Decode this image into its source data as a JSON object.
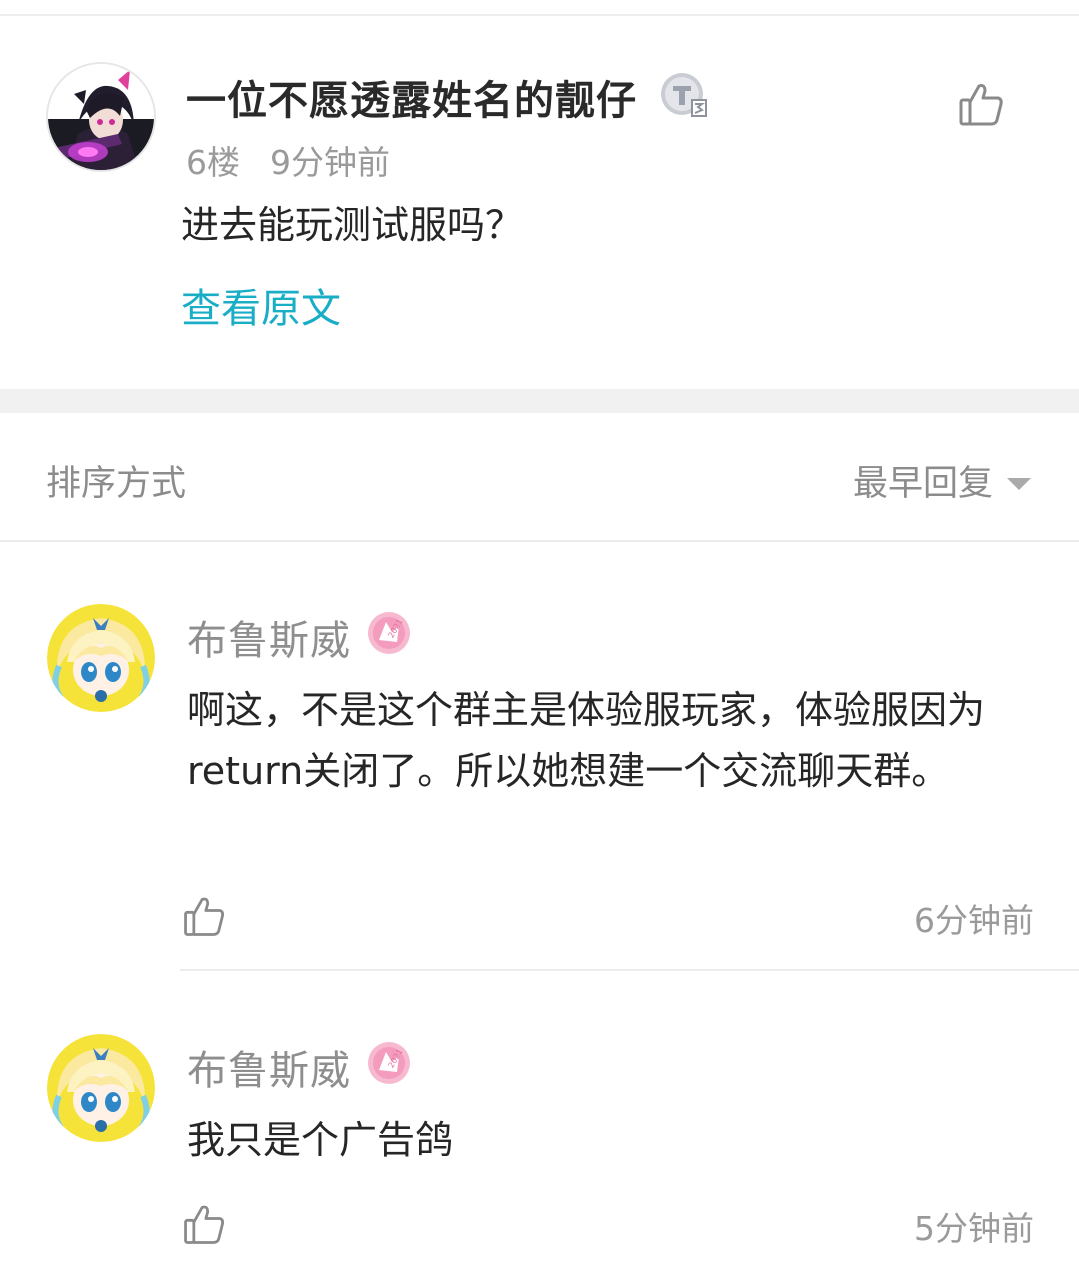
{
  "post": {
    "author": "一位不愿透露姓名的靓仔",
    "level_badge": "T3",
    "floor": "6楼",
    "time": "9分钟前",
    "text": "进去能玩测试服吗？",
    "view_original": "查看原文",
    "icons": {
      "like": "thumbs-up-icon"
    }
  },
  "sort": {
    "label": "排序方式",
    "value": "最早回复",
    "icons": {
      "dropdown": "caret-down-icon"
    }
  },
  "replies": [
    {
      "author": "布鲁斯威",
      "badge": "2021",
      "text": "啊这，不是这个群主是体验服玩家，体验服因为return关闭了。所以她想建一个交流聊天群。",
      "time": "6分钟前"
    },
    {
      "author": "布鲁斯威",
      "badge": "2021",
      "text": "我只是个广告鸽",
      "time": "5分钟前"
    }
  ],
  "colors": {
    "accent_link": "#19aec6",
    "muted_text": "#9a9a9a",
    "badge_pink": "#f3a6c3"
  }
}
